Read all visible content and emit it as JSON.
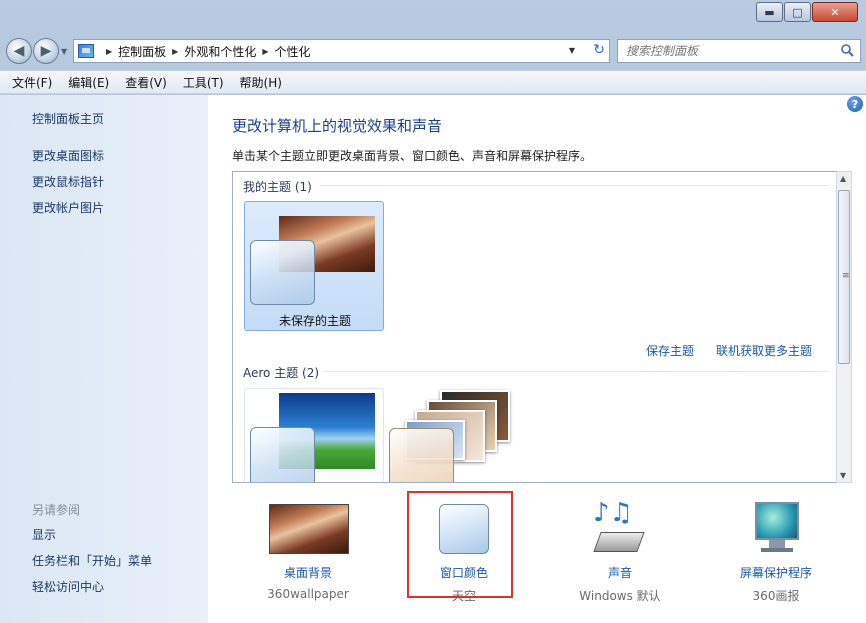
{
  "window": {
    "caption_buttons": {
      "minimize": "▬",
      "maximize": "□",
      "close": "✕"
    }
  },
  "nav": {
    "back": "◀",
    "forward": "▶",
    "dropdown": "▼"
  },
  "address": {
    "icon": "control-panel-icon",
    "breadcrumb": [
      "控制面板",
      "外观和个性化",
      "个性化"
    ],
    "separator": "▶",
    "dropdown": "▼",
    "refresh": "↻"
  },
  "search": {
    "placeholder": "搜索控制面板",
    "value": ""
  },
  "menu": [
    "文件(F)",
    "编辑(E)",
    "查看(V)",
    "工具(T)",
    "帮助(H)"
  ],
  "sidebar": {
    "home": "控制面板主页",
    "links": [
      "更改桌面图标",
      "更改鼠标指针",
      "更改帐户图片"
    ],
    "see_also_title": "另请参阅",
    "see_also": [
      "显示",
      "任务栏和「开始」菜单",
      "轻松访问中心"
    ]
  },
  "main": {
    "help": "?",
    "heading": "更改计算机上的视觉效果和声音",
    "subheading": "单击某个主题立即更改桌面背景、窗口颜色、声音和屏幕保护程序。",
    "my_themes": {
      "title": "我的主题 (1)",
      "tile_label": "未保存的主题",
      "save_link": "保存主题",
      "online_link": "联机获取更多主题"
    },
    "aero_themes": {
      "title": "Aero 主题 (2)"
    },
    "scroll": {
      "up": "▲",
      "down": "▼",
      "grip": "≡"
    }
  },
  "bottom": [
    {
      "label": "桌面背景",
      "sub": "360wallpaper",
      "icon": "desktop-background-icon"
    },
    {
      "label": "窗口颜色",
      "sub": "天空",
      "icon": "window-color-icon"
    },
    {
      "label": "声音",
      "sub": "Windows 默认",
      "icon": "sound-icon"
    },
    {
      "label": "屏幕保护程序",
      "sub": "360画报",
      "icon": "screensaver-icon"
    }
  ],
  "colors": {
    "accent": "#1e3f8a",
    "link": "#1b57a8",
    "highlight": "#e0322d",
    "sidebar_bg": "#dbe7f5"
  }
}
